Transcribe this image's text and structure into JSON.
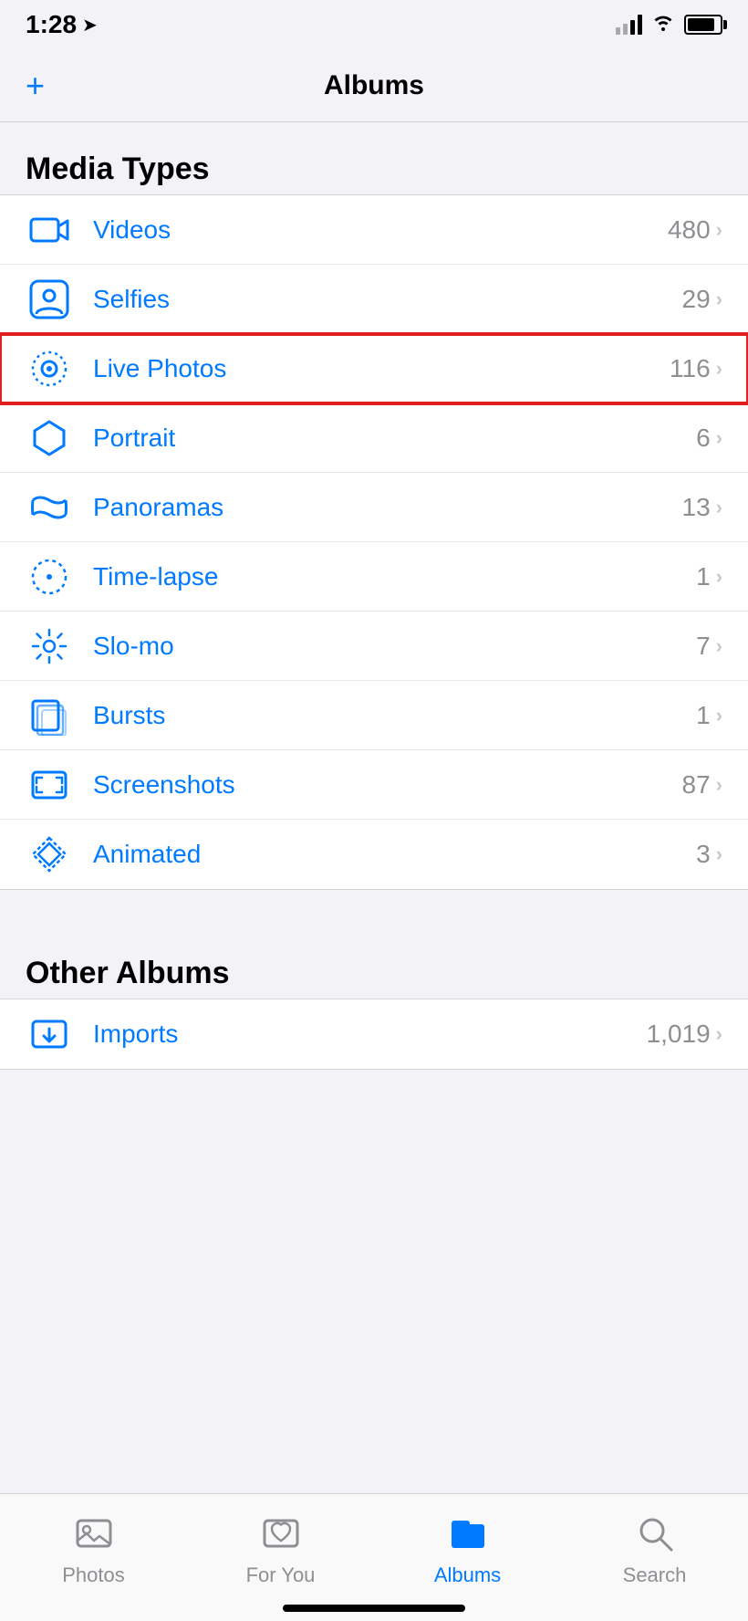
{
  "statusBar": {
    "time": "1:28",
    "locationIcon": "➤"
  },
  "header": {
    "addLabel": "+",
    "title": "Albums"
  },
  "mediaTypes": {
    "sectionTitle": "Media Types",
    "items": [
      {
        "id": "videos",
        "label": "Videos",
        "count": "480",
        "highlighted": false
      },
      {
        "id": "selfies",
        "label": "Selfies",
        "count": "29",
        "highlighted": false
      },
      {
        "id": "live-photos",
        "label": "Live Photos",
        "count": "116",
        "highlighted": true
      },
      {
        "id": "portrait",
        "label": "Portrait",
        "count": "6",
        "highlighted": false
      },
      {
        "id": "panoramas",
        "label": "Panoramas",
        "count": "13",
        "highlighted": false
      },
      {
        "id": "time-lapse",
        "label": "Time-lapse",
        "count": "1",
        "highlighted": false
      },
      {
        "id": "slo-mo",
        "label": "Slo-mo",
        "count": "7",
        "highlighted": false
      },
      {
        "id": "bursts",
        "label": "Bursts",
        "count": "1",
        "highlighted": false
      },
      {
        "id": "screenshots",
        "label": "Screenshots",
        "count": "87",
        "highlighted": false
      },
      {
        "id": "animated",
        "label": "Animated",
        "count": "3",
        "highlighted": false
      }
    ]
  },
  "otherAlbums": {
    "sectionTitle": "Other Albums",
    "items": [
      {
        "id": "imports",
        "label": "Imports",
        "count": "1,019",
        "highlighted": false
      }
    ]
  },
  "tabBar": {
    "items": [
      {
        "id": "photos",
        "label": "Photos",
        "active": false
      },
      {
        "id": "for-you",
        "label": "For You",
        "active": false
      },
      {
        "id": "albums",
        "label": "Albums",
        "active": true
      },
      {
        "id": "search",
        "label": "Search",
        "active": false
      }
    ]
  },
  "colors": {
    "blue": "#007aff",
    "gray": "#8e8e93",
    "separator": "#e5e5ea",
    "red": "#e02020"
  }
}
